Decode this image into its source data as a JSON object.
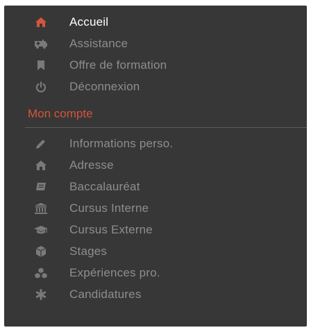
{
  "menu": {
    "items": [
      {
        "label": "Accueil",
        "icon": "home-icon",
        "active": true
      },
      {
        "label": "Assistance",
        "icon": "ambulance-icon",
        "active": false
      },
      {
        "label": "Offre de formation",
        "icon": "bookmark-icon",
        "active": false
      },
      {
        "label": "Déconnexion",
        "icon": "power-icon",
        "active": false
      }
    ]
  },
  "account": {
    "title": "Mon compte",
    "items": [
      {
        "label": "Informations perso.",
        "icon": "pencil-icon"
      },
      {
        "label": "Adresse",
        "icon": "home-icon"
      },
      {
        "label": "Baccalauréat",
        "icon": "book-icon"
      },
      {
        "label": "Cursus Interne",
        "icon": "institution-icon"
      },
      {
        "label": "Cursus Externe",
        "icon": "graduation-cap-icon"
      },
      {
        "label": "Stages",
        "icon": "cube-icon"
      },
      {
        "label": "Expériences pro.",
        "icon": "cubes-icon"
      },
      {
        "label": "Candidatures",
        "icon": "asterisk-icon"
      }
    ]
  },
  "colors": {
    "background": "#373737",
    "active_icon": "#d5553a",
    "section_title": "#d5553a",
    "inactive_text": "#8e8e8e",
    "active_text": "#ffffff"
  }
}
